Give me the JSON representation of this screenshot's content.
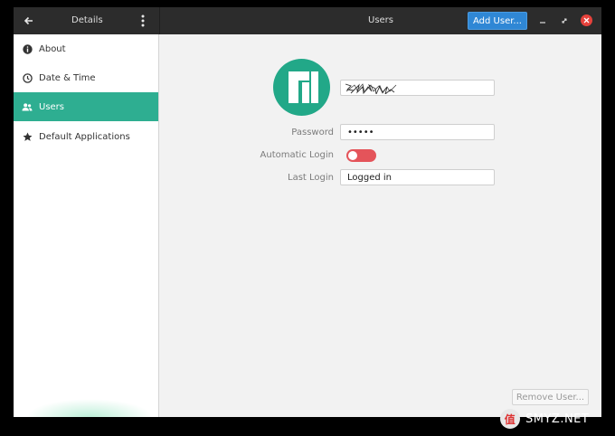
{
  "titlebar": {
    "left_title": "Details",
    "main_title": "Users",
    "add_user_label": "Add User...",
    "minimize_glyph": "–",
    "maximize_glyph": "⤢",
    "close_glyph": "✕"
  },
  "sidebar": {
    "items": [
      {
        "label": "About",
        "icon": "info-icon",
        "active": false
      },
      {
        "label": "Date & Time",
        "icon": "clock-icon",
        "active": false
      },
      {
        "label": "Users",
        "icon": "users-icon",
        "active": true
      },
      {
        "label": "Default Applications",
        "icon": "star-icon",
        "active": false
      }
    ]
  },
  "user": {
    "password_label": "Password",
    "password_value": "•••••",
    "auto_login_label": "Automatic Login",
    "auto_login_on": false,
    "last_login_label": "Last Login",
    "last_login_value": "Logged in",
    "remove_label": "Remove User..."
  },
  "watermark": {
    "text": "SMYZ.NET",
    "logo_char": "值"
  },
  "colors": {
    "accent": "#2eae91",
    "avatar": "#22a888",
    "primary_button": "#2f87d5",
    "toggle_off": "#e4545a",
    "close_button": "#e6423c",
    "titlebar": "#2c2c2c"
  }
}
